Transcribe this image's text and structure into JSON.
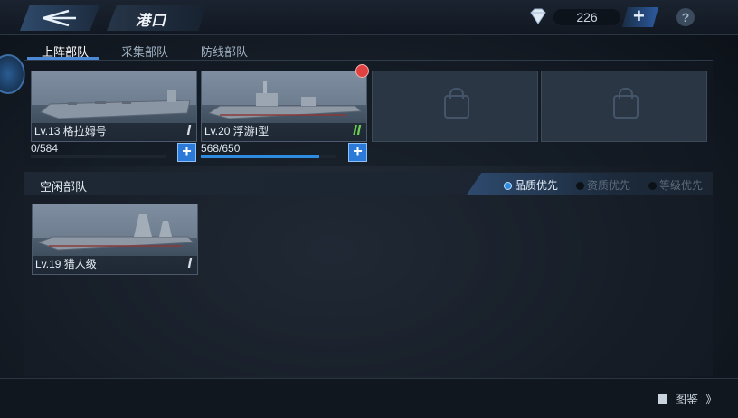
{
  "header": {
    "title": "港口",
    "gem_count": "226",
    "help": "?"
  },
  "tabs": [
    {
      "label": "上阵部队",
      "active": true
    },
    {
      "label": "采集部队",
      "active": false
    },
    {
      "label": "防线部队",
      "active": false
    }
  ],
  "active_fleet": [
    {
      "label": "Lv.13 格拉姆号",
      "tier": "I",
      "progress_text": "0/584",
      "progress": 0.0,
      "add": "+"
    },
    {
      "label": "Lv.20 浮游I型",
      "tier": "II",
      "progress_text": "568/650",
      "progress": 0.874,
      "add": "+"
    }
  ],
  "idle": {
    "title": "空闲部队",
    "sort_options": [
      {
        "label": "品质优先",
        "selected": true
      },
      {
        "label": "资质优先",
        "selected": false
      },
      {
        "label": "等级优先",
        "selected": false
      }
    ],
    "ships": [
      {
        "label": "Lv.19 猎人级",
        "tier": "I"
      }
    ]
  },
  "footer": {
    "codex_label": "图鉴",
    "arrow": "》"
  },
  "colors": {
    "accent": "#2f8be0",
    "tier_green": "#6bcf4f",
    "badge_red": "#e04141"
  },
  "icons": [
    "back-arrow-icon",
    "diamond-icon",
    "plus-icon",
    "help-icon",
    "lock-icon",
    "book-icon"
  ]
}
